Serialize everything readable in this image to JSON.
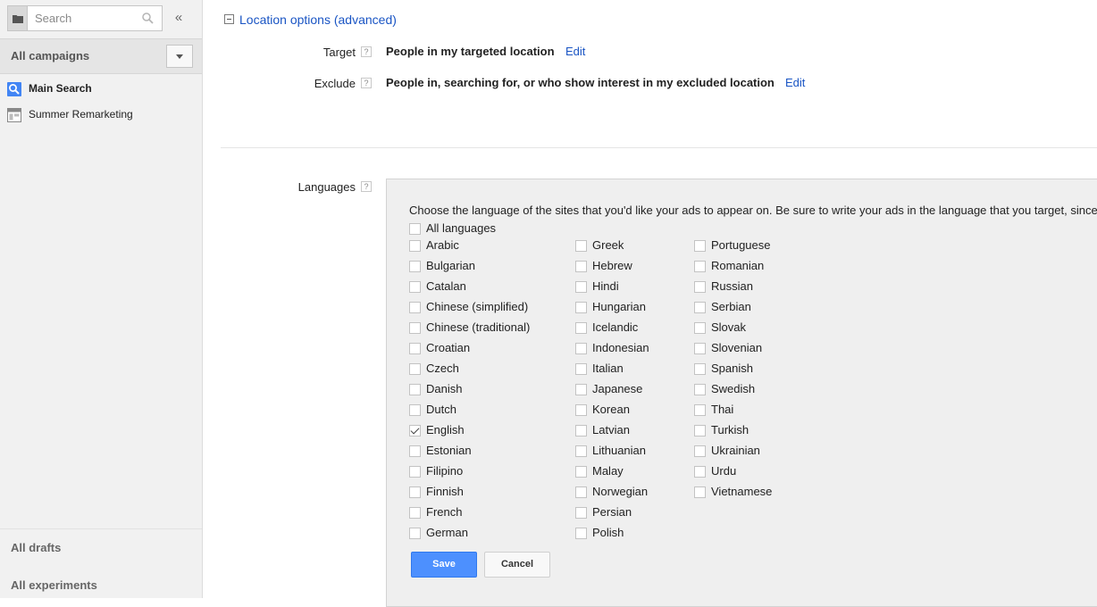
{
  "sidebar": {
    "search_placeholder": "Search",
    "collapse_glyph": "«",
    "all_campaigns_label": "All campaigns",
    "campaigns": [
      {
        "label": "Main Search",
        "icon": "search-icon",
        "active": true
      },
      {
        "label": "Summer Remarketing",
        "icon": "display-campaign-icon",
        "active": false
      }
    ],
    "footer": {
      "all_drafts": "All drafts",
      "all_experiments": "All experiments"
    }
  },
  "location_options": {
    "title": "Location options (advanced)",
    "target_label": "Target",
    "target_value": "People in my targeted location",
    "exclude_label": "Exclude",
    "exclude_value": "People in, searching for, or who show interest in my excluded location",
    "edit_label": "Edit",
    "help_glyph": "?"
  },
  "languages": {
    "label": "Languages",
    "instructions": "Choose the language of the sites that you'd like your ads to appear on. Be sure to write your ads in the language that you target, since",
    "all_languages": {
      "label": "All languages",
      "checked": false
    },
    "columns": [
      [
        {
          "label": "Arabic",
          "checked": false
        },
        {
          "label": "Bulgarian",
          "checked": false
        },
        {
          "label": "Catalan",
          "checked": false
        },
        {
          "label": "Chinese (simplified)",
          "checked": false
        },
        {
          "label": "Chinese (traditional)",
          "checked": false
        },
        {
          "label": "Croatian",
          "checked": false
        },
        {
          "label": "Czech",
          "checked": false
        },
        {
          "label": "Danish",
          "checked": false
        },
        {
          "label": "Dutch",
          "checked": false
        },
        {
          "label": "English",
          "checked": true
        },
        {
          "label": "Estonian",
          "checked": false
        },
        {
          "label": "Filipino",
          "checked": false
        },
        {
          "label": "Finnish",
          "checked": false
        },
        {
          "label": "French",
          "checked": false
        },
        {
          "label": "German",
          "checked": false
        }
      ],
      [
        {
          "label": "Greek",
          "checked": false
        },
        {
          "label": "Hebrew",
          "checked": false
        },
        {
          "label": "Hindi",
          "checked": false
        },
        {
          "label": "Hungarian",
          "checked": false
        },
        {
          "label": "Icelandic",
          "checked": false
        },
        {
          "label": "Indonesian",
          "checked": false
        },
        {
          "label": "Italian",
          "checked": false
        },
        {
          "label": "Japanese",
          "checked": false
        },
        {
          "label": "Korean",
          "checked": false
        },
        {
          "label": "Latvian",
          "checked": false
        },
        {
          "label": "Lithuanian",
          "checked": false
        },
        {
          "label": "Malay",
          "checked": false
        },
        {
          "label": "Norwegian",
          "checked": false
        },
        {
          "label": "Persian",
          "checked": false
        },
        {
          "label": "Polish",
          "checked": false
        }
      ],
      [
        {
          "label": "Portuguese",
          "checked": false
        },
        {
          "label": "Romanian",
          "checked": false
        },
        {
          "label": "Russian",
          "checked": false
        },
        {
          "label": "Serbian",
          "checked": false
        },
        {
          "label": "Slovak",
          "checked": false
        },
        {
          "label": "Slovenian",
          "checked": false
        },
        {
          "label": "Spanish",
          "checked": false
        },
        {
          "label": "Swedish",
          "checked": false
        },
        {
          "label": "Thai",
          "checked": false
        },
        {
          "label": "Turkish",
          "checked": false
        },
        {
          "label": "Ukrainian",
          "checked": false
        },
        {
          "label": "Urdu",
          "checked": false
        },
        {
          "label": "Vietnamese",
          "checked": false
        }
      ]
    ],
    "save_label": "Save",
    "cancel_label": "Cancel"
  },
  "colors": {
    "link": "#1a55c4",
    "primary_button": "#4d90fe",
    "sidebar_bg": "#f1f1f1",
    "panel_bg": "#efefef",
    "search_campaign_icon": "#4285f4"
  }
}
